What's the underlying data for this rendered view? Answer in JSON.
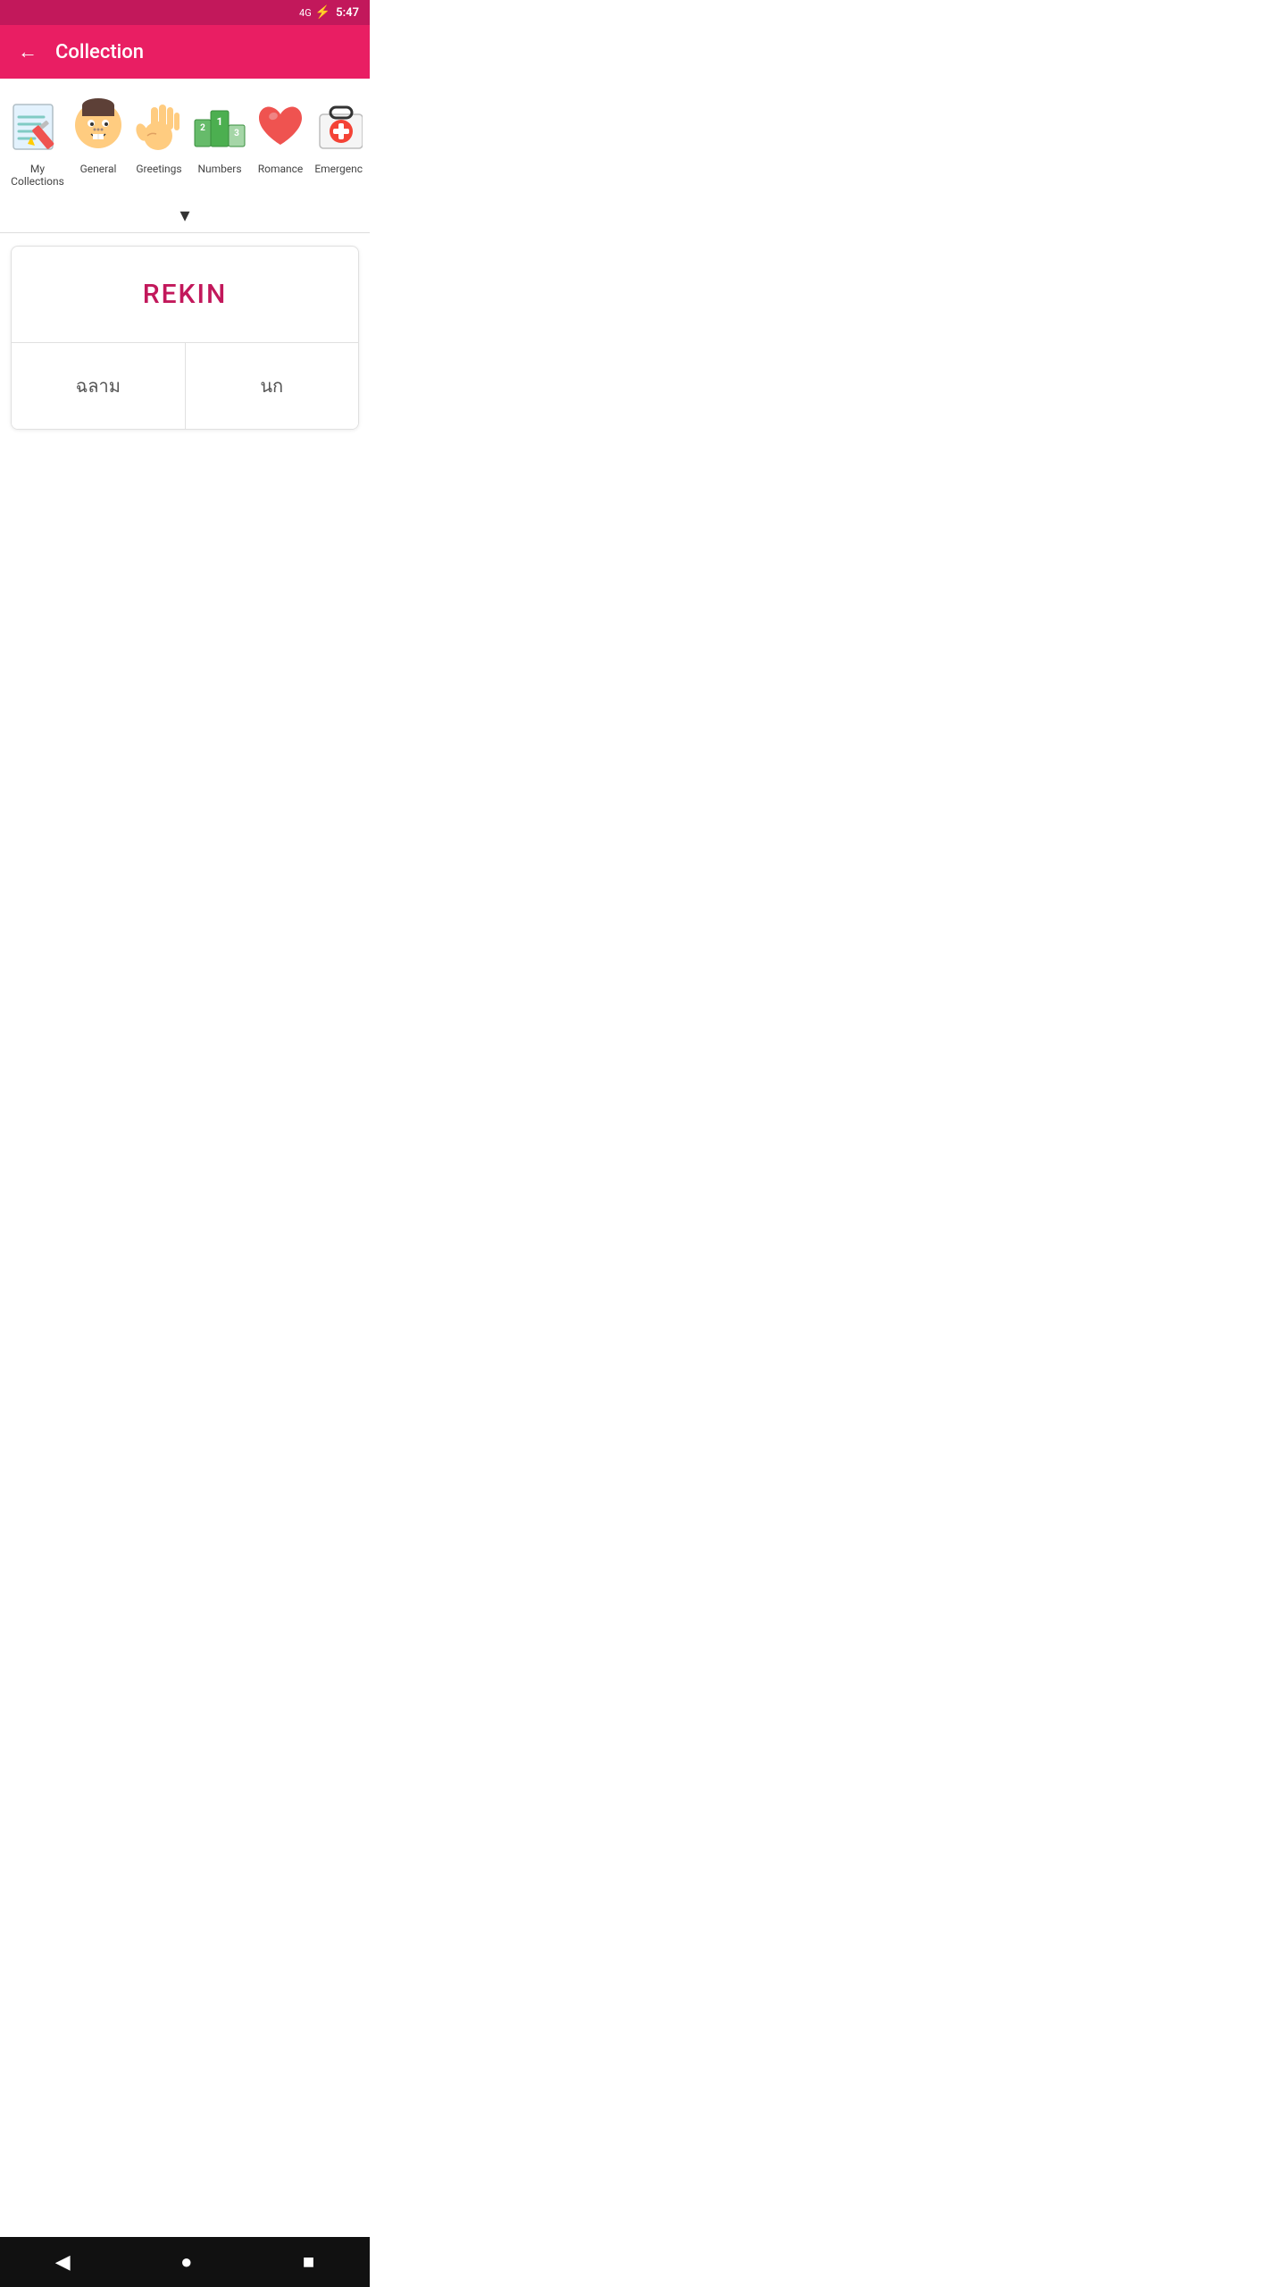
{
  "statusBar": {
    "time": "5:47",
    "signal": "4G",
    "batteryIcon": "⚡"
  },
  "appBar": {
    "title": "Collection",
    "backLabel": "←"
  },
  "categories": [
    {
      "id": "my-collections",
      "label": "My Collections",
      "iconType": "my-collections"
    },
    {
      "id": "general",
      "label": "General",
      "iconType": "general"
    },
    {
      "id": "greetings",
      "label": "Greetings",
      "iconType": "greetings"
    },
    {
      "id": "numbers",
      "label": "Numbers",
      "iconType": "numbers"
    },
    {
      "id": "romance",
      "label": "Romance",
      "iconType": "romance"
    },
    {
      "id": "emergency",
      "label": "Emergency",
      "iconType": "emergency"
    }
  ],
  "chevron": "▾",
  "card": {
    "word": "REKIN",
    "answerLeft": "ฉลาม",
    "answerRight": "นก"
  },
  "bottomNav": {
    "backLabel": "◀",
    "homeLabel": "●",
    "squareLabel": "■"
  }
}
